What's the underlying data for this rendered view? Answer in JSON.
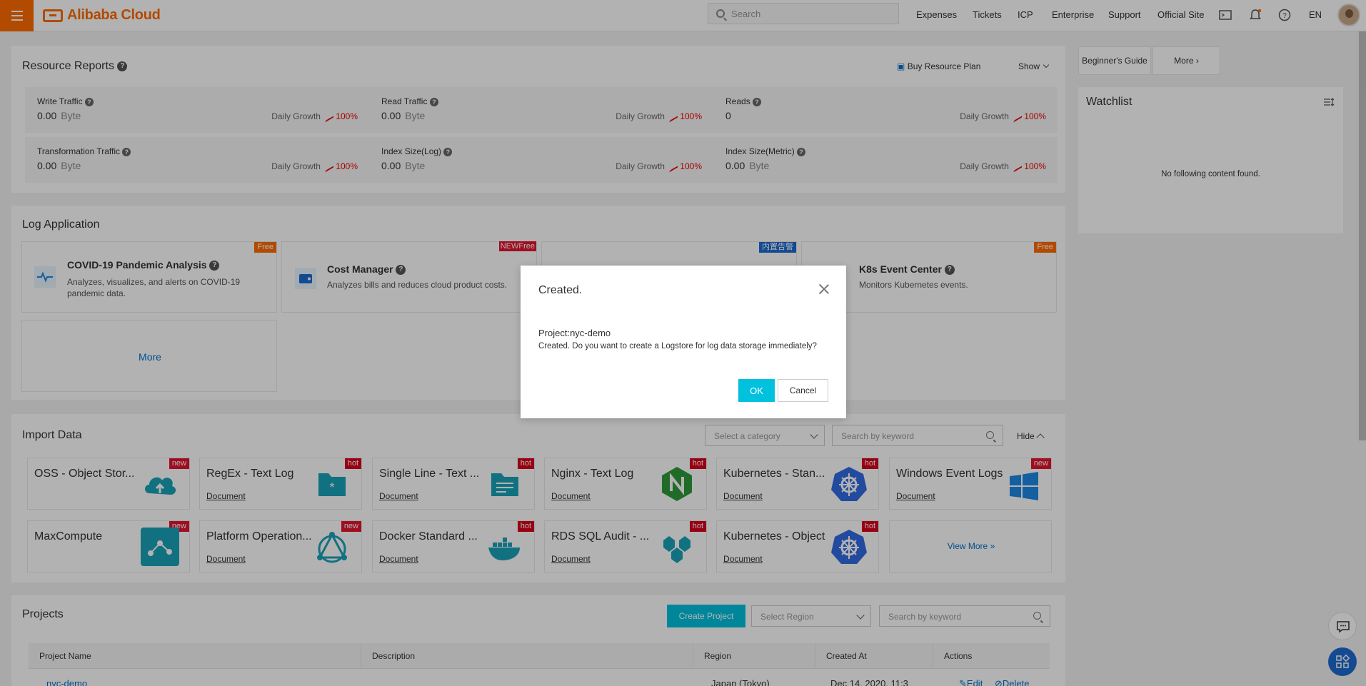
{
  "topbar": {
    "brand": "Alibaba Cloud",
    "search_placeholder": "Search",
    "nav": [
      "Expenses",
      "Tickets",
      "ICP",
      "Enterprise",
      "Support",
      "Official Site"
    ],
    "lang": "EN"
  },
  "resource_reports": {
    "title": "Resource Reports",
    "buy_plan": "Buy Resource Plan",
    "show": "Show",
    "growth_label": "Daily Growth",
    "metrics": [
      {
        "title": "Write Traffic",
        "value": "0.00",
        "unit": "Byte",
        "growth": "100%"
      },
      {
        "title": "Read Traffic",
        "value": "0.00",
        "unit": "Byte",
        "growth": "100%"
      },
      {
        "title": "Reads",
        "value": "0",
        "unit": "",
        "growth": "100%"
      },
      {
        "title": "Transformation Traffic",
        "value": "0.00",
        "unit": "Byte",
        "growth": "100%"
      },
      {
        "title": "Index Size(Log)",
        "value": "0.00",
        "unit": "Byte",
        "growth": "100%"
      },
      {
        "title": "Index Size(Metric)",
        "value": "0.00",
        "unit": "Byte",
        "growth": "100%"
      }
    ]
  },
  "sidebar": {
    "beginners_guide": "Beginner's Guide",
    "more": "More",
    "watchlist_title": "Watchlist",
    "watchlist_empty": "No following content found."
  },
  "log_application": {
    "title": "Log Application",
    "cards": [
      {
        "title": "COVID-19 Pandemic Analysis",
        "desc": "Analyzes, visualizes, and alerts on COVID-19 pandemic data.",
        "badge": "Free"
      },
      {
        "title": "Cost Manager",
        "desc": "Analyzes bills and reduces cloud product costs.",
        "badge": "NEWFree"
      },
      {
        "title": "",
        "desc": "",
        "badge": "内置告警"
      },
      {
        "title": "K8s Event Center",
        "desc": "Monitors Kubernetes events.",
        "badge": "Free"
      }
    ],
    "more": "More"
  },
  "import_data": {
    "title": "Import Data",
    "category_placeholder": "Select a category",
    "search_placeholder": "Search by keyword",
    "hide": "Hide",
    "doc_label": "Document",
    "cards": [
      {
        "title": "OSS - Object Stor...",
        "badge": "new",
        "doc": "",
        "icon": "oss-cloud-icon"
      },
      {
        "title": "RegEx - Text Log",
        "badge": "hot",
        "doc": "Document",
        "icon": "regex-folder-icon"
      },
      {
        "title": "Single Line - Text ...",
        "badge": "hot",
        "doc": "Document",
        "icon": "text-folder-icon"
      },
      {
        "title": "Nginx - Text Log",
        "badge": "hot",
        "doc": "Document",
        "icon": "nginx-icon"
      },
      {
        "title": "Kubernetes - Stan...",
        "badge": "hot",
        "doc": "Document",
        "icon": "kubernetes-icon"
      },
      {
        "title": "Windows Event Logs",
        "badge": "new",
        "doc": "Document",
        "icon": "windows-icon"
      },
      {
        "title": "MaxCompute",
        "badge": "new",
        "doc": "",
        "icon": "maxcompute-icon"
      },
      {
        "title": "Platform Operation...",
        "badge": "new",
        "doc": "Document",
        "icon": "platform-icon"
      },
      {
        "title": "Docker Standard ...",
        "badge": "hot",
        "doc": "Document",
        "icon": "docker-icon"
      },
      {
        "title": "RDS SQL Audit - ...",
        "badge": "hot",
        "doc": "Document",
        "icon": "rds-icon"
      },
      {
        "title": "Kubernetes - Object",
        "badge": "hot",
        "doc": "Document",
        "icon": "kubernetes-icon"
      }
    ],
    "view_more": "View More"
  },
  "projects": {
    "title": "Projects",
    "create_button": "Create Project",
    "region_placeholder": "Select Region",
    "search_placeholder": "Search by keyword",
    "columns": [
      "Project Name",
      "Description",
      "Region",
      "Created At",
      "Actions"
    ],
    "rows": [
      {
        "name": "nyc-demo",
        "description": "",
        "region": "Japan (Tokyo)",
        "created": "Dec 14, 2020, 11:3",
        "edit": "Edit",
        "delete": "Delete"
      }
    ]
  },
  "dialog": {
    "title": "Created.",
    "project_line": "Project:nyc-demo",
    "message": "Created. Do you want to create a Logstore for log data storage immediately?",
    "ok": "OK",
    "cancel": "Cancel"
  },
  "colors": {
    "brand_orange": "#ff6a00",
    "primary_button": "#00c1de",
    "link": "#0070cc",
    "growth_red": "#e00000"
  }
}
